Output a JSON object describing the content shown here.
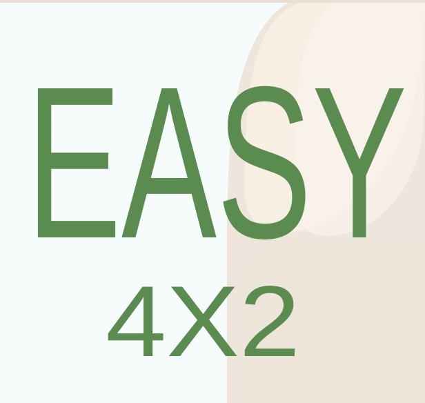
{
  "logo": {
    "title": "EASY",
    "subtitle": "4X2",
    "text_color": "#5a8c50",
    "background_color": "#f6fcfc",
    "accent_color": "#eee5db"
  }
}
